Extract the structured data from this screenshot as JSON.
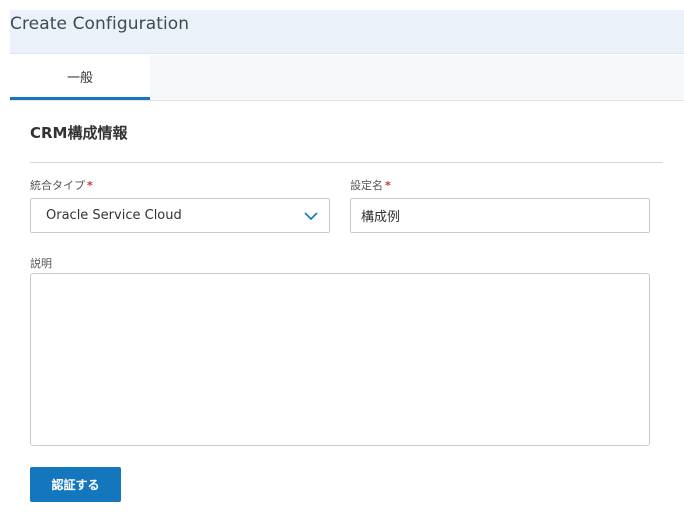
{
  "header": {
    "title": "Create Configuration"
  },
  "tabs": [
    {
      "label": "一般",
      "active": true
    }
  ],
  "section": {
    "title": "CRM構成情報"
  },
  "form": {
    "integration_type": {
      "label": "統合タイプ",
      "required_mark": "*",
      "value": "Oracle Service Cloud",
      "icon": "chevron-down-icon"
    },
    "config_name": {
      "label": "設定名",
      "required_mark": "*",
      "value": "構成例"
    },
    "description": {
      "label": "説明",
      "value": ""
    },
    "submit": {
      "label": "認証する"
    }
  },
  "colors": {
    "accent": "#1477bd",
    "header_bg": "#eaf1f8",
    "required": "#d32f2f",
    "chevron": "#1477bd"
  }
}
